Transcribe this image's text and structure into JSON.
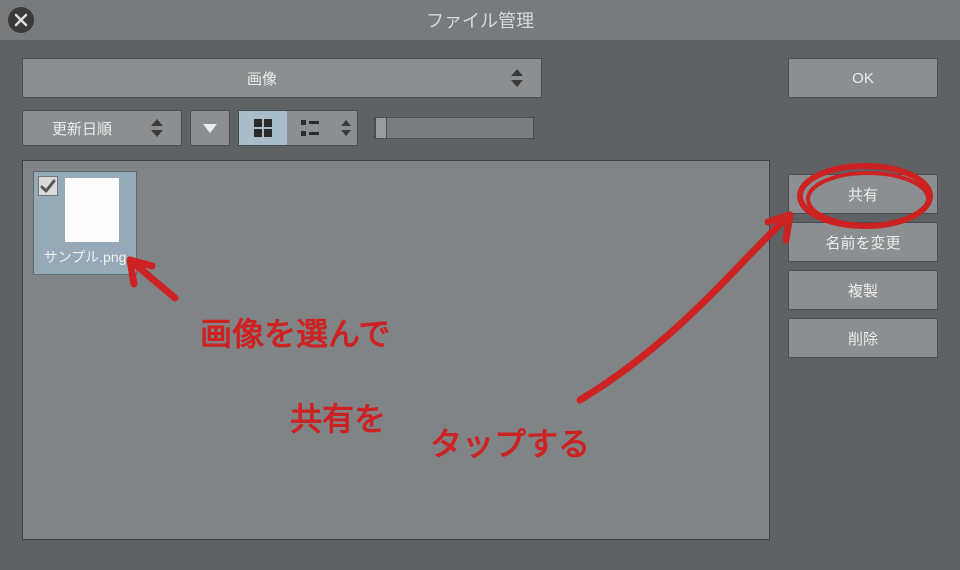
{
  "titlebar": {
    "title": "ファイル管理"
  },
  "toolbar": {
    "category": "画像",
    "sort": "更新日順"
  },
  "files": [
    {
      "name": "サンプル.png",
      "checked": true
    }
  ],
  "sidebar": {
    "ok": "OK",
    "share": "共有",
    "rename": "名前を変更",
    "duplicate": "複製",
    "delete": "削除"
  },
  "annotations": {
    "line1": "画像を選んで",
    "line2": "共有を",
    "line3": "タップする"
  }
}
